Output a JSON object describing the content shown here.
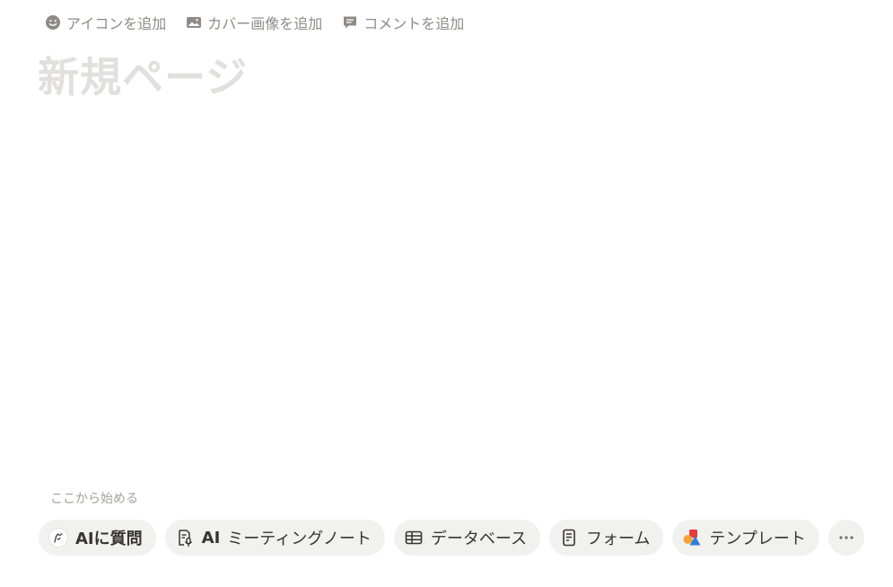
{
  "top_actions": {
    "add_icon": "アイコンを追加",
    "add_cover": "カバー画像を追加",
    "add_comment": "コメントを追加"
  },
  "page": {
    "title_placeholder": "新規ページ"
  },
  "start": {
    "label": "ここから始める",
    "chips": {
      "ask_ai": "AIに質問",
      "ai_meeting_notes_prefix": "AI",
      "ai_meeting_notes": "ミーティングノート",
      "database": "データベース",
      "form": "フォーム",
      "template": "テンプレート",
      "more": "…"
    }
  },
  "colors": {
    "title_placeholder": "#e1e0de",
    "muted_text": "#8e8b86",
    "chip_bg": "#f1f1ef",
    "text": "#37352f"
  }
}
